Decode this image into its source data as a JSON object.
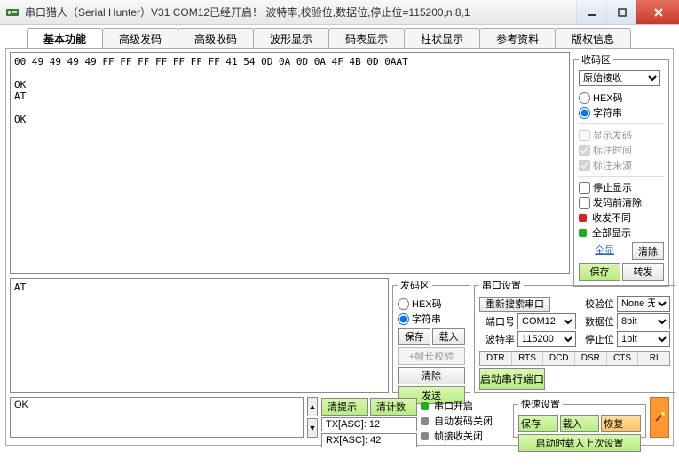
{
  "window": {
    "title": "串口猎人（Serial Hunter）V31    COM12已经开启！ 波特率,校验位,数据位,停止位=115200,n,8,1"
  },
  "tabs": [
    "基本功能",
    "高级发码",
    "高级收码",
    "波形显示",
    "码表显示",
    "柱状显示",
    "参考资料",
    "版权信息"
  ],
  "rx_text": "00 49 49 49 49 FF FF FF FF FF FF FF 41 54 0D 0A 0D 0A 4F 4B 0D 0AAT\n\nOK\nAT\n\nOK",
  "rx_panel": {
    "legend": "收码区",
    "mode_options": [
      "原始接收"
    ],
    "mode_selected": "原始接收",
    "radio_hex": "HEX码",
    "radio_str": "字符串",
    "chk_showtx": "显示发码",
    "chk_ts": "标注时间",
    "chk_src": "标注来源",
    "chk_stop": "停止显示",
    "chk_preclr": "发码前清除",
    "led_diff": "收发不同",
    "led_all": "全部显示",
    "link_full": "全显",
    "btn_clear": "清除",
    "btn_save": "保存",
    "btn_fwd": "转发"
  },
  "tx_text": "AT",
  "tx_panel": {
    "legend": "发码区",
    "radio_hex": "HEX码",
    "radio_str": "字符串",
    "btn_save": "保存",
    "btn_load": "载入",
    "btn_crc": "+帧长校验",
    "btn_clear": "清除",
    "btn_send": "发送"
  },
  "port_panel": {
    "legend": "串口设置",
    "btn_rescan": "重新搜索串口",
    "lbl_port": "端口号",
    "lbl_baud": "波特率",
    "lbl_parity": "校验位",
    "lbl_data": "数据位",
    "lbl_stop": "停止位",
    "val_port": "COM12",
    "val_baud": "115200",
    "val_parity": "None 无",
    "val_data": "8bit",
    "val_stop": "1bit",
    "signals": [
      "DTR",
      "RTS",
      "DCD",
      "DSR",
      "CTS",
      "RI"
    ],
    "btn_start": "启动串行端口"
  },
  "bottom": {
    "ok_text": "OK",
    "btn_clrtip": "清提示",
    "btn_clrcnt": "清计数",
    "lbl_tx": "TX[ASC]:",
    "val_tx": "12",
    "lbl_rx": "RX[ASC]:",
    "val_rx": "42",
    "status_open": "串口开启",
    "status_autotx": "自动发码关闭",
    "status_framerx": "帧接收关闭",
    "quick_legend": "快速设置",
    "btn_qsave": "保存",
    "btn_qload": "载入",
    "btn_qrestore": "恢复",
    "btn_qstart": "启动时载入上次设置"
  }
}
